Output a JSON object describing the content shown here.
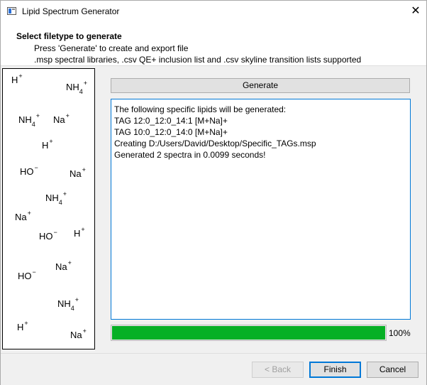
{
  "window": {
    "title": "Lipid Spectrum Generator",
    "close_glyph": "✕"
  },
  "header": {
    "title": "Select filetype to generate",
    "line1": "Press 'Generate' to create and export file",
    "line2": ".msp spectral libraries, .csv QE+ inclusion list and .csv skyline transition lists supported"
  },
  "ions": [
    {
      "label": "H",
      "sub": "",
      "sup": "+"
    },
    {
      "label": "NH",
      "sub": "4",
      "sup": "+"
    },
    {
      "label": "NH",
      "sub": "4",
      "sup": "+"
    },
    {
      "label": "Na",
      "sub": "",
      "sup": "+"
    },
    {
      "label": "H",
      "sub": "",
      "sup": "+"
    },
    {
      "label": "HO",
      "sub": "",
      "sup": "−"
    },
    {
      "label": "Na",
      "sub": "",
      "sup": "+"
    },
    {
      "label": "NH",
      "sub": "4",
      "sup": "+"
    },
    {
      "label": "Na",
      "sub": "",
      "sup": "+"
    },
    {
      "label": "HO",
      "sub": "",
      "sup": "−"
    },
    {
      "label": "H",
      "sub": "",
      "sup": "+"
    },
    {
      "label": "Na",
      "sub": "",
      "sup": "+"
    },
    {
      "label": "HO",
      "sub": "",
      "sup": "−"
    },
    {
      "label": "NH",
      "sub": "4",
      "sup": "+"
    },
    {
      "label": "H",
      "sub": "",
      "sup": "+"
    },
    {
      "label": "Na",
      "sub": "",
      "sup": "+"
    }
  ],
  "generate_label": "Generate",
  "log": [
    "The following specific lipids will be generated:",
    "TAG 12:0_12:0_14:1 [M+Na]+",
    "TAG 10:0_12:0_14:0 [M+Na]+",
    "Creating D:/Users/David/Desktop/Specific_TAGs.msp",
    "Generated 2 spectra in 0.0099 seconds!"
  ],
  "progress": {
    "value": 100,
    "label": "100%",
    "color": "#06b025"
  },
  "footer": {
    "back_label": "< Back",
    "finish_label": "Finish",
    "cancel_label": "Cancel"
  },
  "colors": {
    "accent": "#0078d7"
  }
}
